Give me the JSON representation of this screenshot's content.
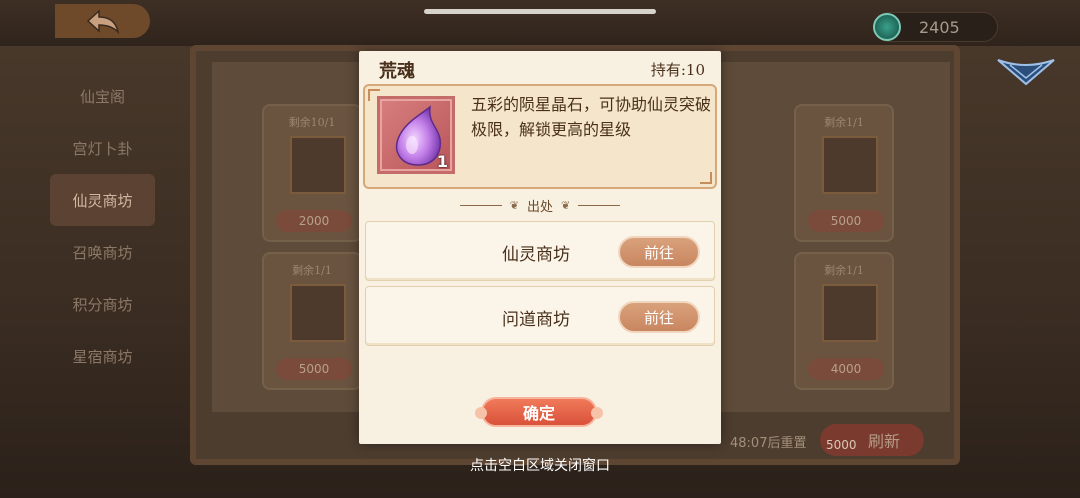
{
  "top_bar": {
    "currency_amount": "2405",
    "currency_icon": "jade-coin-icon",
    "back_icon": "back-arrow-icon"
  },
  "side_nav": {
    "items": [
      {
        "label": "仙宝阁"
      },
      {
        "label": "宫灯卜卦"
      },
      {
        "label": "仙灵商坊",
        "active": true
      },
      {
        "label": "召唤商坊"
      },
      {
        "label": "积分商坊"
      },
      {
        "label": "星宿商坊"
      }
    ]
  },
  "shop_cards": [
    {
      "remain": "剩余10/1",
      "price": "2000"
    },
    {
      "remain": "剩余1/1",
      "price": "5000"
    },
    {
      "remain": "剩余1/1",
      "price": "5000"
    },
    {
      "remain": "剩余1/1",
      "price": "4000"
    }
  ],
  "footer": {
    "timer": "48:07后重置",
    "refresh_cost": "5000",
    "refresh_label": "刷新"
  },
  "modal": {
    "item_name": "荒魂",
    "own_count": "持有:10",
    "item_quantity": "1",
    "description": "五彩的陨星晶石，可协助仙灵突破极限，解锁更高的星级",
    "source_title": "出处",
    "sources": [
      {
        "label": "仙灵商坊",
        "button": "前往"
      },
      {
        "label": "问道商坊",
        "button": "前往"
      }
    ],
    "confirm_label": "确定"
  },
  "close_hint": "点击空白区域关闭窗口",
  "colors": {
    "modal_bg": "#f8f1e1",
    "goto_button": "#c88660",
    "confirm_button": "#d9513a",
    "item_frame": "#b8555a"
  }
}
